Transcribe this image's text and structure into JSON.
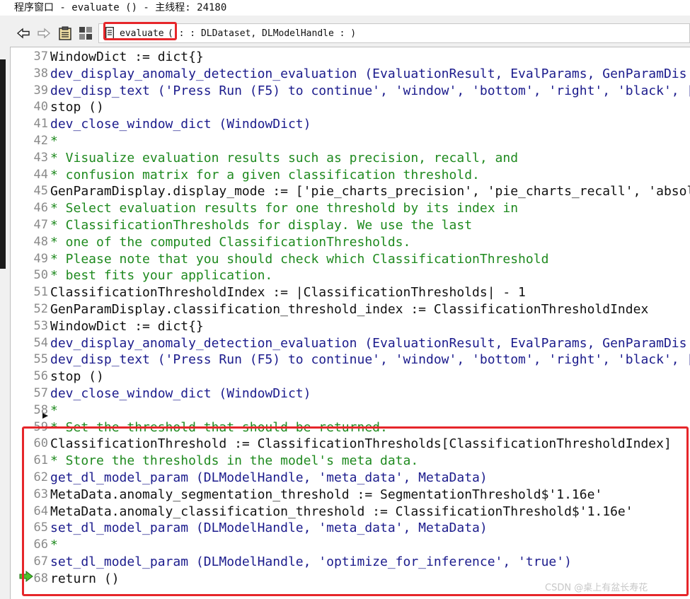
{
  "window": {
    "title": "程序窗口 - evaluate () - 主线程: 24180"
  },
  "toolbar": {
    "back_icon": "back-arrow-icon",
    "forward_icon": "forward-arrow-icon",
    "clipboard_icon": "clipboard-icon",
    "grid_icon": "grid-icon",
    "procedure_name": "evaluate",
    "procedure_signature": "( : : DLDataset, DLModelHandle : )"
  },
  "editor": {
    "lines": [
      {
        "num": "37",
        "type": "op",
        "text": "WindowDict := dict{}"
      },
      {
        "num": "38",
        "type": "proc",
        "text": "dev_display_anomaly_detection_evaluation (EvaluationResult, EvalParams, GenParamDis"
      },
      {
        "num": "39",
        "type": "proc",
        "text": "dev_disp_text ('Press Run (F5) to continue', 'window', 'bottom', 'right', 'black', ["
      },
      {
        "num": "40",
        "type": "op",
        "text": "stop ()"
      },
      {
        "num": "41",
        "type": "proc",
        "text": "dev_close_window_dict (WindowDict)"
      },
      {
        "num": "42",
        "type": "comment",
        "text": "*"
      },
      {
        "num": "43",
        "type": "comment",
        "text": "* Visualize evaluation results such as precision, recall, and"
      },
      {
        "num": "44",
        "type": "comment",
        "text": "* confusion matrix for a given classification threshold."
      },
      {
        "num": "45",
        "type": "op",
        "text": "GenParamDisplay.display_mode := ['pie_charts_precision', 'pie_charts_recall', 'absol"
      },
      {
        "num": "46",
        "type": "comment",
        "text": "* Select evaluation results for one threshold by its index in"
      },
      {
        "num": "47",
        "type": "comment",
        "text": "* ClassificationThresholds for display. We use the last"
      },
      {
        "num": "48",
        "type": "comment",
        "text": "* one of the computed ClassificationThresholds."
      },
      {
        "num": "49",
        "type": "comment",
        "text": "* Please note that you should check which ClassificationThreshold"
      },
      {
        "num": "50",
        "type": "comment",
        "text": "* best fits your application."
      },
      {
        "num": "51",
        "type": "op",
        "text": "ClassificationThresholdIndex := |ClassificationThresholds| - 1"
      },
      {
        "num": "52",
        "type": "op",
        "text": "GenParamDisplay.classification_threshold_index := ClassificationThresholdIndex"
      },
      {
        "num": "53",
        "type": "op",
        "text": "WindowDict := dict{}"
      },
      {
        "num": "54",
        "type": "proc",
        "text": "dev_display_anomaly_detection_evaluation (EvaluationResult, EvalParams, GenParamDis"
      },
      {
        "num": "55",
        "type": "proc",
        "text": "dev_disp_text ('Press Run (F5) to continue', 'window', 'bottom', 'right', 'black', ["
      },
      {
        "num": "56",
        "type": "op",
        "text": "stop ()"
      },
      {
        "num": "57",
        "type": "proc",
        "text": "dev_close_window_dict (WindowDict)"
      },
      {
        "num": "58",
        "type": "comment",
        "text": "*"
      },
      {
        "num": "59",
        "type": "comment",
        "text": "* Set the threshold that should be returned."
      },
      {
        "num": "60",
        "type": "op",
        "text": "ClassificationThreshold := ClassificationThresholds[ClassificationThresholdIndex]"
      },
      {
        "num": "61",
        "type": "comment",
        "text": "* Store the thresholds in the model's meta data."
      },
      {
        "num": "62",
        "type": "proc",
        "text": "get_dl_model_param (DLModelHandle, 'meta_data', MetaData)"
      },
      {
        "num": "63",
        "type": "op",
        "text": "MetaData.anomaly_segmentation_threshold := SegmentationThreshold$'1.16e'"
      },
      {
        "num": "64",
        "type": "op",
        "text": "MetaData.anomaly_classification_threshold := ClassificationThreshold$'1.16e'"
      },
      {
        "num": "65",
        "type": "proc",
        "text": "set_dl_model_param (DLModelHandle, 'meta_data', MetaData)"
      },
      {
        "num": "66",
        "type": "comment",
        "text": "*"
      },
      {
        "num": "67",
        "type": "proc",
        "text": "set_dl_model_param (DLModelHandle, 'optimize_for_inference', 'true')"
      },
      {
        "num": "68",
        "type": "return",
        "text": "return ()"
      }
    ]
  },
  "markers": {
    "insert_marker_icon": "insert-cursor-icon",
    "pc_marker_icon": "program-counter-arrow-icon"
  },
  "watermark": "CSDN @桌上有盆长寿花",
  "colors": {
    "highlight": "#e6262a",
    "comment": "#1f8a1f",
    "procedure": "#1b1b8c"
  }
}
